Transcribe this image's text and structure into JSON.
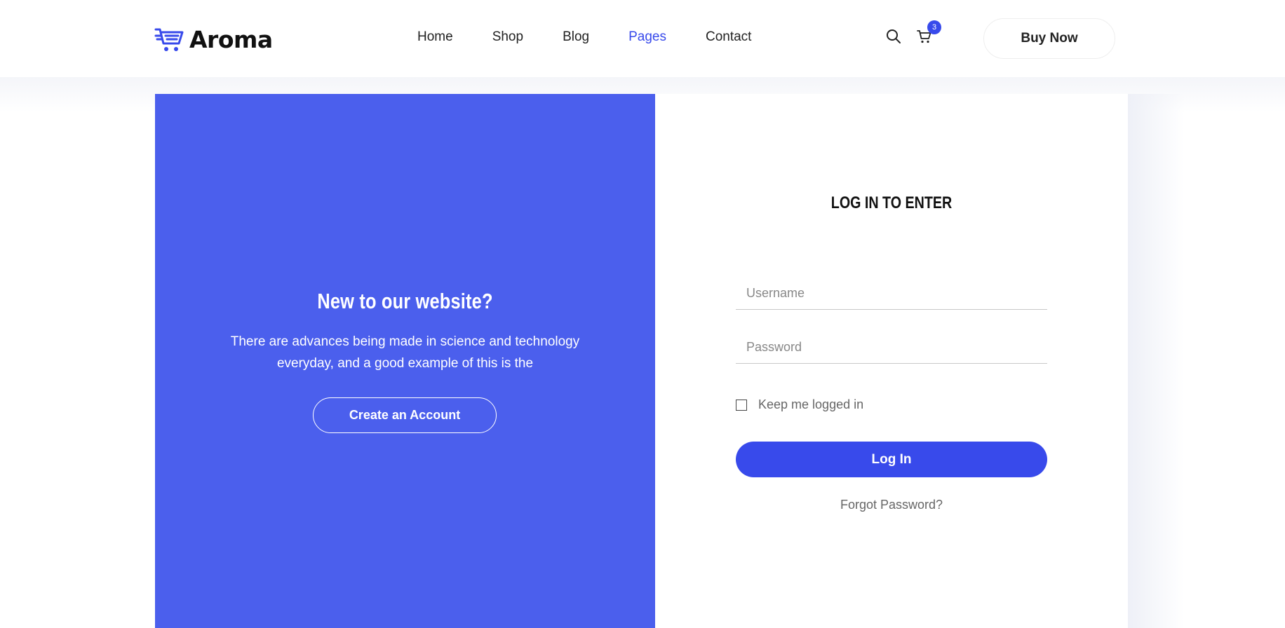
{
  "header": {
    "brand": "Aroma",
    "nav": [
      "Home",
      "Shop",
      "Blog",
      "Pages",
      "Contact"
    ],
    "active_nav": "Pages",
    "cart_count": "3",
    "buy_label": "Buy Now"
  },
  "register": {
    "title": "New to our website?",
    "text": "There are advances being made in science and technology everyday, and a good example of this is the",
    "button": "Create an Account"
  },
  "login": {
    "title": "LOG IN TO ENTER",
    "username_placeholder": "Username",
    "password_placeholder": "Password",
    "remember_label": "Keep me logged in",
    "submit_label": "Log In",
    "forgot_label": "Forgot Password?"
  },
  "colors": {
    "accent": "#384aeb",
    "panel": "#4b5fed"
  },
  "icons": [
    "cart-logo-icon",
    "search-icon",
    "cart-icon"
  ]
}
